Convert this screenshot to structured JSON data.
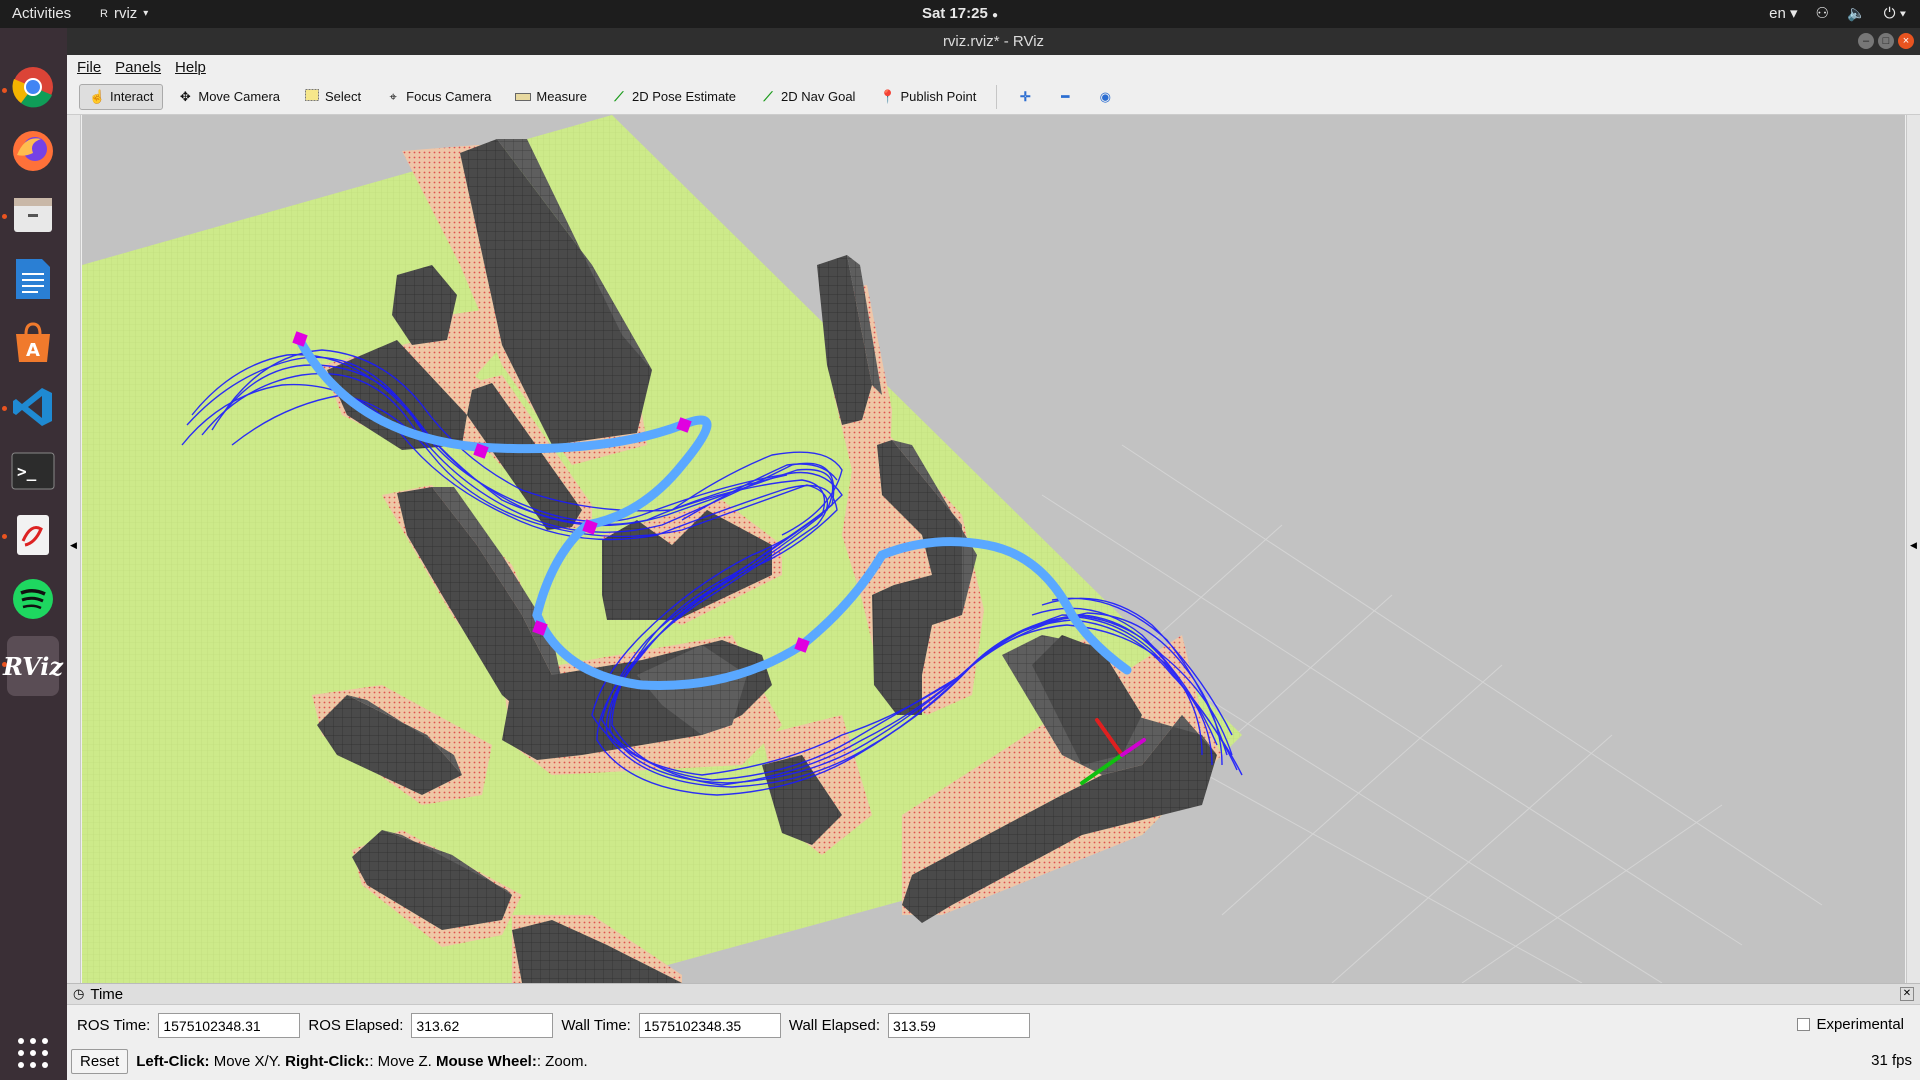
{
  "topbar": {
    "activities": "Activities",
    "app_name": "rviz",
    "clock": "Sat 17:25",
    "lang": "en"
  },
  "dock": {
    "items": [
      "chrome",
      "firefox",
      "files",
      "writer",
      "software",
      "vscode",
      "terminal",
      "evince",
      "spotify",
      "rviz"
    ]
  },
  "window": {
    "title": "rviz.rviz* - RViz"
  },
  "menu": {
    "file": "File",
    "panels": "Panels",
    "help": "Help"
  },
  "toolbar": {
    "interact": "Interact",
    "move_camera": "Move Camera",
    "select": "Select",
    "focus_camera": "Focus Camera",
    "measure": "Measure",
    "pose_estimate": "2D Pose Estimate",
    "nav_goal": "2D Nav Goal",
    "publish_point": "Publish Point"
  },
  "time_panel": {
    "header": "Time",
    "ros_time_label": "ROS Time:",
    "ros_time": "1575102348.31",
    "ros_elapsed_label": "ROS Elapsed:",
    "ros_elapsed": "313.62",
    "wall_time_label": "Wall Time:",
    "wall_time": "1575102348.35",
    "wall_elapsed_label": "Wall Elapsed:",
    "wall_elapsed": "313.59",
    "experimental": "Experimental"
  },
  "status": {
    "reset": "Reset",
    "left_click": "Left-Click:",
    "left_click_desc": "Move X/Y.",
    "right_click": "Right-Click:",
    "right_click_desc": ": Move Z.",
    "wheel": "Mouse Wheel:",
    "wheel_desc": ": Zoom.",
    "fps": "31 fps"
  },
  "colors": {
    "floor": "#cdea8a",
    "obstacle": "#4a4a4a",
    "trajectory_samples": "#1a1aff",
    "planned_path": "#5aa8ff",
    "waypoint": "#e000e0"
  }
}
